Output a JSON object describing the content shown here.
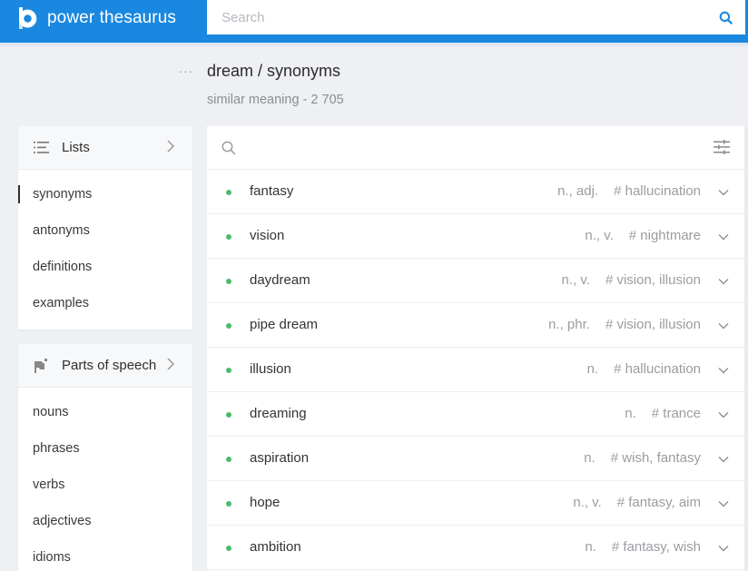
{
  "header": {
    "brand_name": "power thesaurus",
    "logo_icon": "power-thesaurus-logo",
    "search_placeholder": "Search",
    "search_value": "",
    "search_icon": "search-icon",
    "accent_color": "#1a88e0"
  },
  "page": {
    "more_label": "···",
    "title": "dream / synonyms",
    "subtitle": "similar meaning - 2 705"
  },
  "lists": {
    "title": "Lists",
    "icon": "list-icon",
    "items": [
      {
        "label": "synonyms",
        "active": true
      },
      {
        "label": "antonyms",
        "active": false
      },
      {
        "label": "definitions",
        "active": false
      },
      {
        "label": "examples",
        "active": false
      }
    ]
  },
  "parts_of_speech": {
    "title": "Parts of speech",
    "icon": "flag-icon",
    "items": [
      {
        "label": "nouns"
      },
      {
        "label": "phrases"
      },
      {
        "label": "verbs"
      },
      {
        "label": "adjectives"
      },
      {
        "label": "idioms"
      }
    ]
  },
  "results": {
    "filter_placeholder": "",
    "filter_value": "",
    "dot_color": "#4cbb6c",
    "rows": [
      {
        "word": "fantasy",
        "pos": "n., adj.",
        "tags": "# hallucination"
      },
      {
        "word": "vision",
        "pos": "n., v.",
        "tags": "# nightmare"
      },
      {
        "word": "daydream",
        "pos": "n., v.",
        "tags": "# vision, illusion"
      },
      {
        "word": "pipe dream",
        "pos": "n., phr.",
        "tags": "# vision, illusion"
      },
      {
        "word": "illusion",
        "pos": "n.",
        "tags": "# hallucination"
      },
      {
        "word": "dreaming",
        "pos": "n.",
        "tags": "# trance"
      },
      {
        "word": "aspiration",
        "pos": "n.",
        "tags": "# wish, fantasy"
      },
      {
        "word": "hope",
        "pos": "n., v.",
        "tags": "# fantasy, aim"
      },
      {
        "word": "ambition",
        "pos": "n.",
        "tags": "# fantasy, wish"
      }
    ]
  }
}
